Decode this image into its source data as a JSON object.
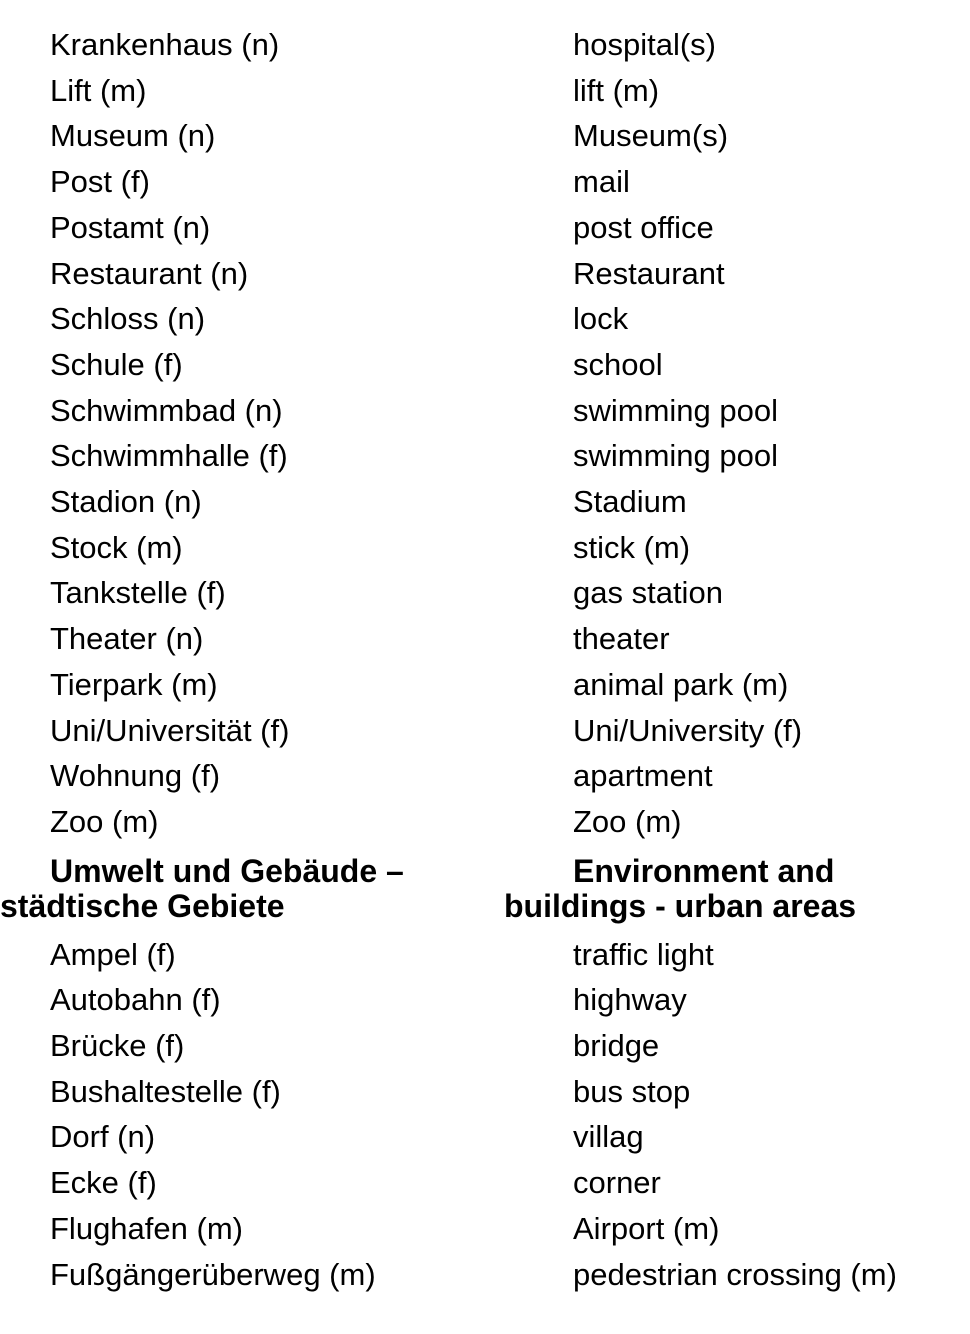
{
  "document": {
    "language_left": "German",
    "language_right": "English",
    "text_color": "#000000",
    "background_color": "#ffffff"
  },
  "rows": [
    {
      "type": "entry",
      "de": "Krankenhaus (n)",
      "en": "hospital(s)"
    },
    {
      "type": "entry",
      "de": "Lift (m)",
      "en": "lift (m)"
    },
    {
      "type": "entry",
      "de": "Museum (n)",
      "en": "Museum(s)"
    },
    {
      "type": "entry",
      "de": "Post (f)",
      "en": "mail"
    },
    {
      "type": "entry",
      "de": "Postamt (n)",
      "en": "post office"
    },
    {
      "type": "entry",
      "de": "Restaurant (n)",
      "en": "Restaurant"
    },
    {
      "type": "entry",
      "de": "Schloss (n)",
      "en": "lock"
    },
    {
      "type": "entry",
      "de": "Schule (f)",
      "en": "school"
    },
    {
      "type": "entry",
      "de": "Schwimmbad (n)",
      "en": "swimming pool"
    },
    {
      "type": "entry",
      "de": "Schwimmhalle (f)",
      "en": "swimming pool"
    },
    {
      "type": "entry",
      "de": "Stadion (n)",
      "en": "Stadium"
    },
    {
      "type": "entry",
      "de": "Stock (m)",
      "en": "stick (m)"
    },
    {
      "type": "entry",
      "de": "Tankstelle (f)",
      "en": "gas station"
    },
    {
      "type": "entry",
      "de": "Theater (n)",
      "en": "theater"
    },
    {
      "type": "entry",
      "de": "Tierpark (m)",
      "en": "animal park (m)"
    },
    {
      "type": "entry",
      "de": "Uni/Universität (f)",
      "en": "Uni/University (f)"
    },
    {
      "type": "entry",
      "de": "Wohnung (f)",
      "en": "apartment"
    },
    {
      "type": "entry",
      "de": "Zoo (m)",
      "en": "Zoo (m)"
    },
    {
      "type": "heading",
      "de": "Umwelt und Gebäude – städtische Gebiete",
      "en": "Environment and buildings - urban areas"
    },
    {
      "type": "entry",
      "de": "Ampel (f)",
      "en": "traffic light"
    },
    {
      "type": "entry",
      "de": "Autobahn (f)",
      "en": "highway"
    },
    {
      "type": "entry",
      "de": "Brücke (f)",
      "en": "bridge"
    },
    {
      "type": "entry",
      "de": "Bushaltestelle (f)",
      "en": "bus stop"
    },
    {
      "type": "entry",
      "de": "Dorf (n)",
      "en": "villag"
    },
    {
      "type": "entry",
      "de": "Ecke (f)",
      "en": "corner"
    },
    {
      "type": "entry",
      "de": "Flughafen (m)",
      "en": "Airport (m)"
    },
    {
      "type": "entry",
      "de": "Fußgängerüberweg (m)",
      "en": "pedestrian crossing (m)"
    }
  ]
}
